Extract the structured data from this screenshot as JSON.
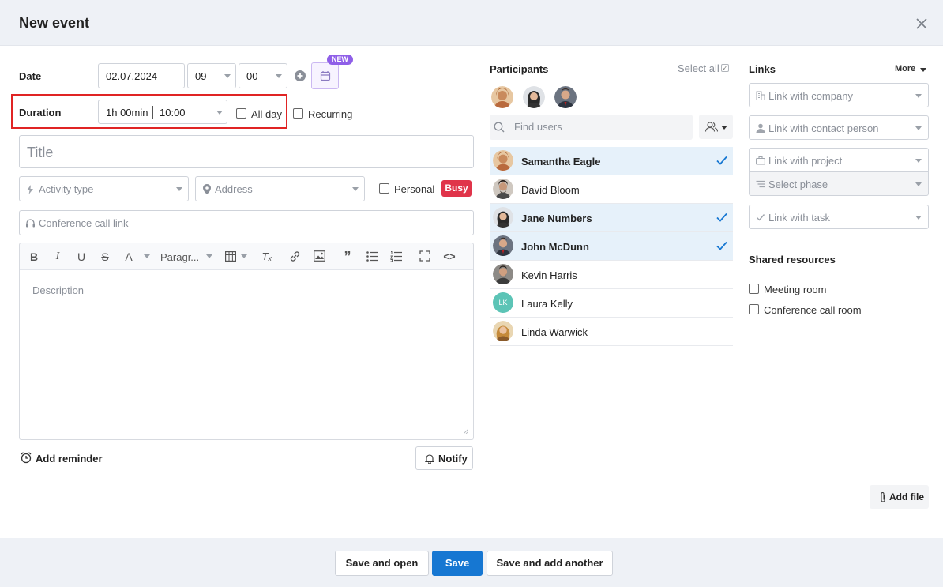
{
  "dialog": {
    "title": "New event"
  },
  "form": {
    "date_label": "Date",
    "date_value": "02.07.2024",
    "hour_value": "09",
    "minute_value": "00",
    "new_badge": "NEW",
    "duration_label": "Duration",
    "duration_value": "1h 00min",
    "end_time": "10:00",
    "all_day_label": "All day",
    "recurring_label": "Recurring",
    "title_placeholder": "Title",
    "activity_placeholder": "Activity type",
    "address_placeholder": "Address",
    "personal_label": "Personal",
    "busy_badge": "Busy",
    "conference_placeholder": "Conference call link",
    "paragraph_label": "Paragr...",
    "description_placeholder": "Description",
    "add_reminder": "Add reminder",
    "notify": "Notify"
  },
  "participants": {
    "title": "Participants",
    "select_all": "Select all",
    "find_placeholder": "Find users",
    "list": [
      {
        "name": "Samantha Eagle",
        "selected": true
      },
      {
        "name": "David Bloom",
        "selected": false
      },
      {
        "name": "Jane Numbers",
        "selected": true
      },
      {
        "name": "John McDunn",
        "selected": true
      },
      {
        "name": "Kevin Harris",
        "selected": false
      },
      {
        "name": "Laura Kelly",
        "selected": false,
        "initials": "LK"
      },
      {
        "name": "Linda Warwick",
        "selected": false
      }
    ]
  },
  "links": {
    "title": "Links",
    "more": "More",
    "company": "Link with company",
    "contact": "Link with contact person",
    "project": "Link with project",
    "phase": "Select phase",
    "task": "Link with task"
  },
  "resources": {
    "title": "Shared resources",
    "items": [
      "Meeting room",
      "Conference call room"
    ]
  },
  "add_file": "Add file",
  "footer": {
    "save_open": "Save and open",
    "save": "Save",
    "save_another": "Save and add another"
  },
  "colors": {
    "accent": "#1677d2",
    "busy": "#e0344a",
    "new_badge": "#8f5fe8",
    "highlight": "#e02424",
    "selected_row": "#e6f1fa"
  }
}
